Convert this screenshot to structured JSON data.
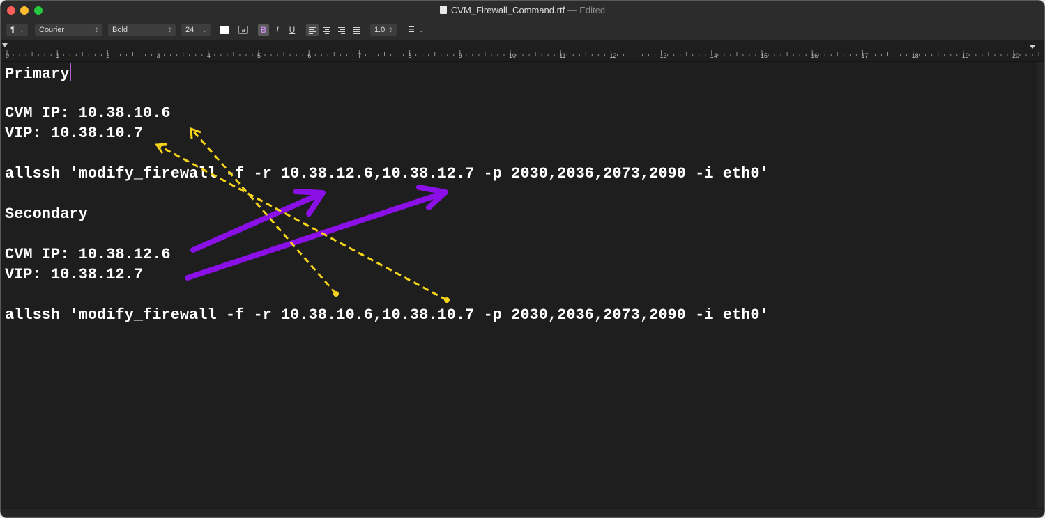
{
  "window": {
    "filename": "CVM_Firewall_Command.rtf",
    "separator": "—",
    "status": "Edited"
  },
  "toolbar": {
    "paragraph_style": "¶",
    "font_family": "Courier",
    "font_style": "Bold",
    "font_size": "24",
    "bold": "B",
    "italic": "I",
    "underline": "U",
    "line_spacing": "1.0",
    "list_icon": "☰",
    "chevron": "⌄"
  },
  "ruler": {
    "labels": [
      "0",
      "1",
      "2",
      "3",
      "4",
      "5",
      "6",
      "7",
      "8",
      "9",
      "10",
      "11",
      "12",
      "13",
      "14",
      "15",
      "16",
      "17",
      "18",
      "19",
      "20"
    ]
  },
  "document": {
    "primary_heading": "Primary",
    "primary_cvm_ip": "CVM IP: 10.38.10.6",
    "primary_vip": "VIP: 10.38.10.7",
    "primary_command": "allssh 'modify_firewall -f -r 10.38.12.6,10.38.12.7 -p 2030,2036,2073,2090 -i eth0'",
    "secondary_heading": "Secondary",
    "secondary_cvm_ip": "CVM IP: 10.38.12.6",
    "secondary_vip": "VIP: 10.38.12.7",
    "secondary_command": "allssh 'modify_firewall -f -r 10.38.10.6,10.38.10.7 -p 2030,2036,2073,2090 -i eth0'"
  },
  "annotations": {
    "purple_arrow_color": "#8b10e8",
    "yellow_arrow_color": "#f5d419"
  }
}
